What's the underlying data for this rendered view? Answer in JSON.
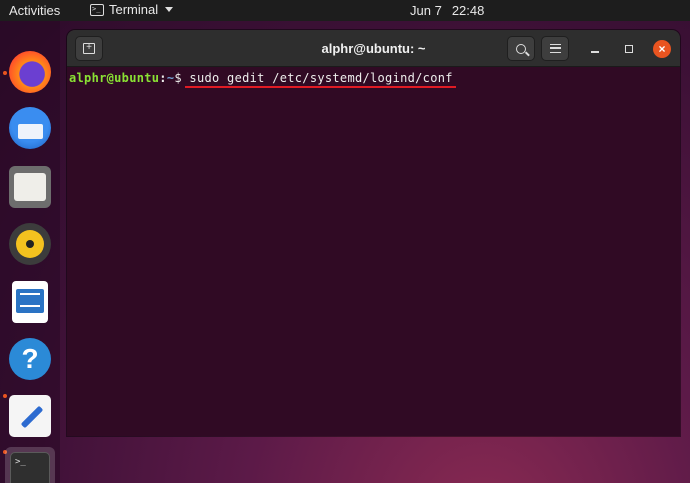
{
  "topbar": {
    "activities": "Activities",
    "app_name": "Terminal",
    "date": "Jun 7",
    "time": "22:48"
  },
  "dock": {
    "items": [
      {
        "name": "Firefox",
        "icon": "firefox-icon",
        "running": true
      },
      {
        "name": "Thunderbird Mail",
        "icon": "thunderbird-icon",
        "running": false
      },
      {
        "name": "Files",
        "icon": "files-icon",
        "running": false
      },
      {
        "name": "Rhythmbox",
        "icon": "rhythmbox-icon",
        "running": false
      },
      {
        "name": "LibreOffice Writer",
        "icon": "writer-icon",
        "running": false
      },
      {
        "name": "Help",
        "icon": "help-icon",
        "running": false,
        "glyph": "?"
      },
      {
        "name": "Text Editor",
        "icon": "text-editor-icon",
        "running": true
      },
      {
        "name": "Terminal",
        "icon": "terminal-icon",
        "running": true,
        "glyph": ">_"
      }
    ]
  },
  "window": {
    "title": "alphr@ubuntu: ~",
    "close_glyph": "×"
  },
  "terminal": {
    "user_host": "alphr@ubuntu",
    "separator": ":",
    "path": "~",
    "dollar": "$ ",
    "command": "sudo gedit /etc/systemd/logind/conf"
  },
  "colors": {
    "terminal_bg": "#300a24",
    "prompt_user": "#8ae234",
    "prompt_path": "#729fcf",
    "highlight_underline": "#e01b24",
    "close_button": "#e95420"
  }
}
